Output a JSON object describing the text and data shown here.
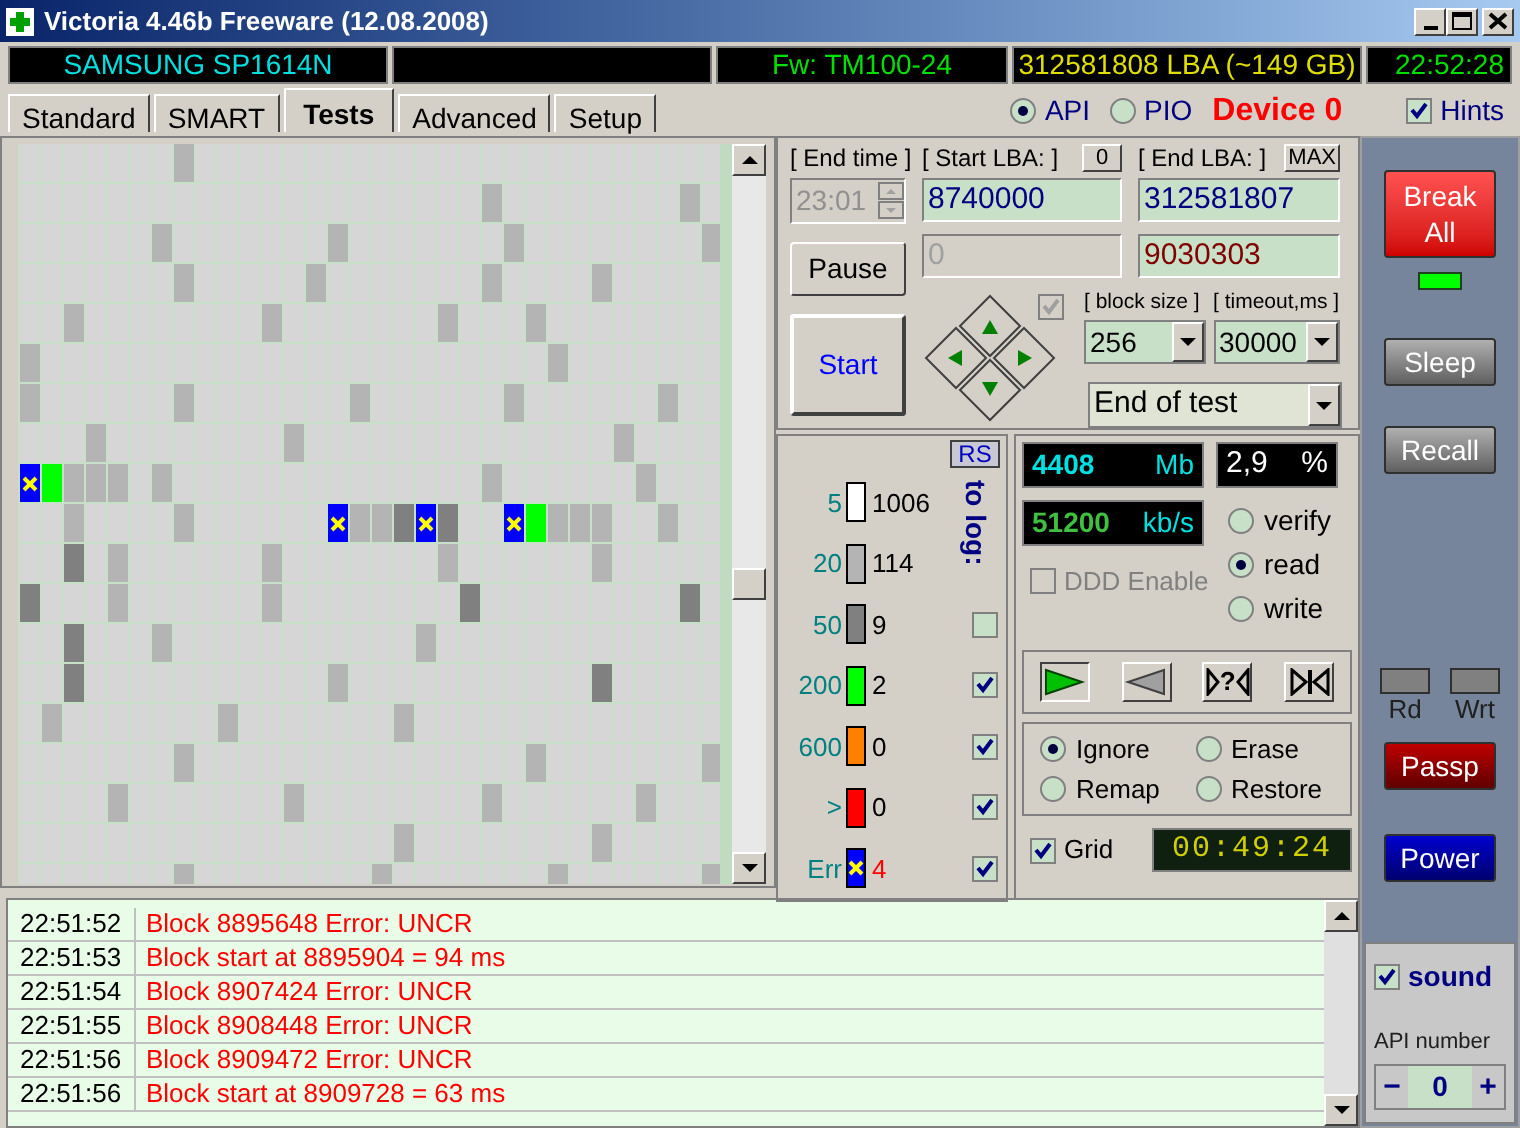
{
  "window": {
    "title": "Victoria 4.46b Freeware (12.08.2008)"
  },
  "info_bar": {
    "model": "SAMSUNG SP1614N",
    "firmware": "Fw: TM100-24",
    "capacity": "312581808 LBA (~149 GB)",
    "clock": "22:52:28"
  },
  "tabs": [
    {
      "label": "Standard",
      "selected": false
    },
    {
      "label": "SMART",
      "selected": false
    },
    {
      "label": "Tests",
      "selected": true
    },
    {
      "label": "Advanced",
      "selected": false
    },
    {
      "label": "Setup",
      "selected": false
    }
  ],
  "interface": [
    {
      "label": "API",
      "selected": true
    },
    {
      "label": "PIO",
      "selected": false
    }
  ],
  "device": "Device 0",
  "hints": {
    "label": "Hints",
    "checked": true
  },
  "test": {
    "end_time_label": "[ End time ]",
    "end_time": "23:01",
    "start_lba_label": "[ Start LBA: ]",
    "zero_button": "0",
    "end_lba_label": "[ End LBA: ]",
    "max_button": "MAX",
    "start_lba": "8740000",
    "end_lba": "312581807",
    "current_lba": "0",
    "position_lba": "9030303",
    "pause": "Pause",
    "start": "Start",
    "pad_checkbox": {
      "checked": true,
      "disabled": true
    },
    "block_size_label": "[ block size ]",
    "block_size": "256",
    "timeout_label": "[ timeout,ms ]",
    "timeout": "30000",
    "end_action": "End of test"
  },
  "stats": {
    "rs": "RS",
    "to_log_label": "to log:",
    "bins": [
      {
        "kind": "delay",
        "threshold": "5",
        "count": "1006",
        "color": "#ffffff"
      },
      {
        "kind": "delay",
        "threshold": "20",
        "count": "114",
        "color": "#b4b4b4"
      },
      {
        "kind": "delay",
        "threshold": "50",
        "count": "9",
        "color": "#808080",
        "to_log": false
      },
      {
        "kind": "delay",
        "threshold": "200",
        "count": "2",
        "color": "#00ff00",
        "to_log": true
      },
      {
        "kind": "delay",
        "threshold": "600",
        "count": "0",
        "color": "#ff8000",
        "to_log": true
      },
      {
        "kind": "delay",
        "threshold": ">",
        "count": "0",
        "color": "#ff0000",
        "to_log": true
      },
      {
        "kind": "error",
        "threshold": "Err",
        "count": "4",
        "color": "#0000ff",
        "to_log": true
      }
    ]
  },
  "readout": {
    "megabytes": "4408",
    "mb_unit": "Mb",
    "percent": "2,9",
    "percent_unit": "%",
    "speed": "51200",
    "speed_unit": "kb/s"
  },
  "ddd": {
    "label": "DDD Enable",
    "checked": false,
    "disabled": true
  },
  "modes": [
    {
      "label": "verify",
      "selected": false
    },
    {
      "label": "read",
      "selected": true
    },
    {
      "label": "write",
      "selected": false
    }
  ],
  "scan_buttons": [
    {
      "kind": "forward",
      "selected": true
    },
    {
      "kind": "backward",
      "selected": false
    },
    {
      "kind": "random",
      "label": "?",
      "selected": false
    },
    {
      "kind": "end",
      "selected": false
    }
  ],
  "repair": [
    {
      "label": "Ignore",
      "selected": true
    },
    {
      "label": "Erase",
      "selected": false
    },
    {
      "label": "Remap",
      "selected": false
    },
    {
      "label": "Restore",
      "selected": false
    }
  ],
  "grid_toggle": {
    "label": "Grid",
    "checked": true
  },
  "timer": "00:49:24",
  "sidebar": {
    "break_all": "Break All",
    "sleep": "Sleep",
    "recall": "Recall",
    "rd": "Rd",
    "wrt": "Wrt",
    "passp": "Passp",
    "power": "Power",
    "sound": {
      "label": "sound",
      "checked": true
    },
    "api_number_label": "API number",
    "api_number": "0",
    "minus": "−",
    "plus": "+"
  },
  "log": [
    {
      "time": "22:51:52",
      "message": "Block 8895648 Error: UNCR"
    },
    {
      "time": "22:51:53",
      "message": "Block start at 8895904 = 94 ms"
    },
    {
      "time": "22:51:54",
      "message": "Block 8907424 Error: UNCR"
    },
    {
      "time": "22:51:55",
      "message": "Block 8908448 Error: UNCR"
    },
    {
      "time": "22:51:56",
      "message": "Block 8909472 Error: UNCR"
    },
    {
      "time": "22:51:56",
      "message": "Block start at 8909728 = 63 ms"
    }
  ]
}
